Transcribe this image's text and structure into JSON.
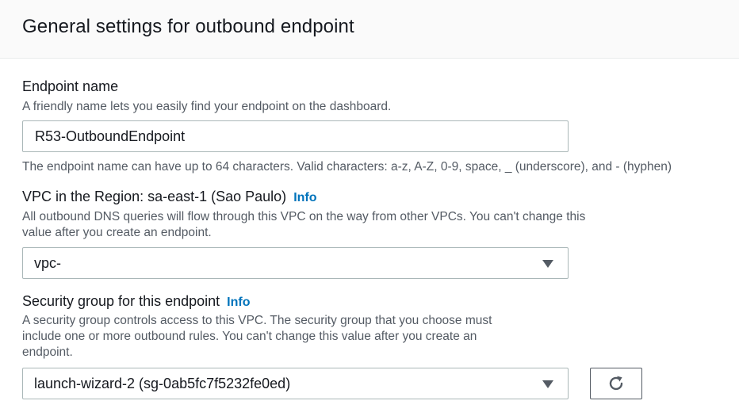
{
  "panel": {
    "title": "General settings for outbound endpoint"
  },
  "endpoint_name": {
    "label": "Endpoint name",
    "description": "A friendly name lets you easily find your endpoint on the dashboard.",
    "value": "R53-OutboundEndpoint",
    "constraint": "The endpoint name can have up to 64 characters. Valid characters: a-z, A-Z, 0-9, space, _ (underscore), and - (hyphen)"
  },
  "vpc": {
    "label": "VPC in the Region: sa-east-1 (Sao Paulo)",
    "info": "Info",
    "description_line1": "All outbound DNS queries will flow through this VPC on the way from other VPCs. You can't change this",
    "description_line2": "value after you create an endpoint.",
    "selected": "vpc-"
  },
  "security_group": {
    "label": "Security group for this endpoint",
    "info": "Info",
    "description_line1": "A security group controls access to this VPC. The security group that you choose must",
    "description_line2": "include one or more outbound rules. You can't change this value after you create an",
    "description_line3": "endpoint.",
    "selected": "launch-wizard-2 (sg-0ab5fc7f5232fe0ed)"
  },
  "icons": {
    "dropdown": "caret-down-icon",
    "refresh": "refresh-icon"
  },
  "colors": {
    "link": "#0073bb",
    "header_bg": "#fafafa",
    "text": "#16191f",
    "secondary_text": "#545b64",
    "border": "#aab7b8"
  }
}
